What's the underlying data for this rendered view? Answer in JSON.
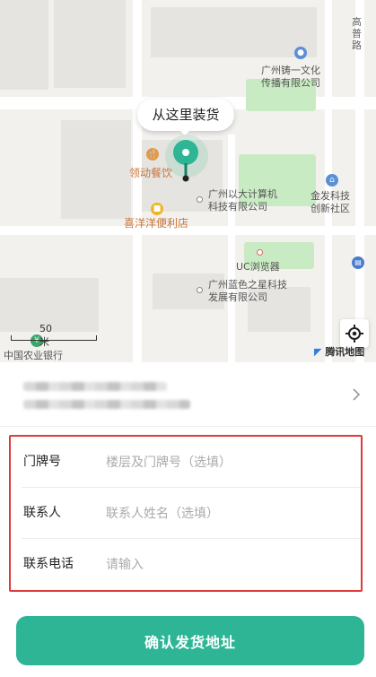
{
  "map": {
    "bubble_text": "从这里装货",
    "scale_label": "50米",
    "attribution": "腾讯地图",
    "pois": {
      "zhuyi": "广州铸一文化\n传播有限公司",
      "canyin": "领动餐饮",
      "yida": "广州以大计算机\n科技有限公司",
      "xiyang": "喜洋洋便利店",
      "jinfa": "金发科技\n创新社区",
      "uc": "UC浏览器",
      "lanse": "广州蓝色之星科技\n发展有限公司",
      "nongye": "中国农业银行",
      "gaopu": "高\n普\n路"
    }
  },
  "form": {
    "door": {
      "label": "门牌号",
      "placeholder": "楼层及门牌号（选填）"
    },
    "contact": {
      "label": "联系人",
      "placeholder": "联系人姓名（选填）"
    },
    "phone": {
      "label": "联系电话",
      "placeholder": "请输入"
    }
  },
  "confirm_button": "确认发货地址",
  "colors": {
    "accent": "#2db595",
    "highlight_border": "#e03a3a",
    "park": "#c9ebc3"
  }
}
